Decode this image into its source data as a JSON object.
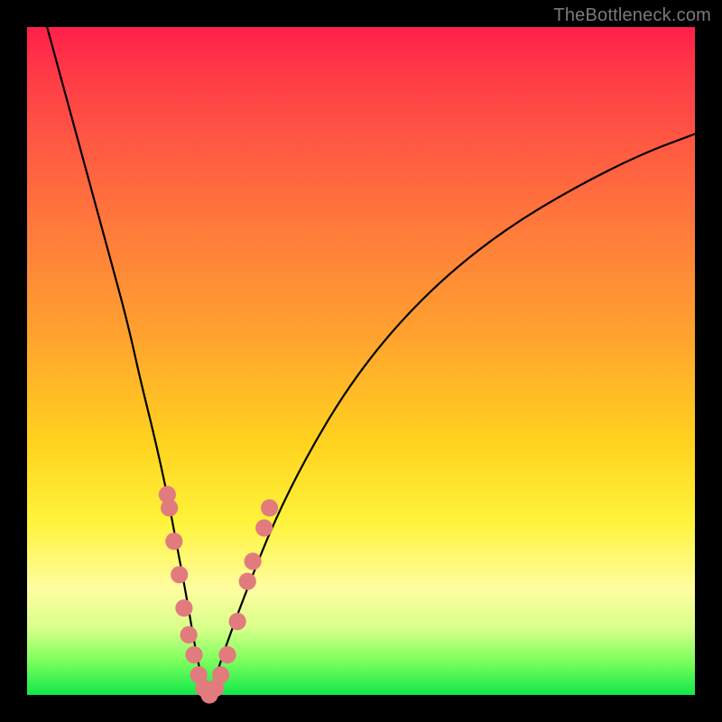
{
  "watermark": "TheBottleneck.com",
  "chart_data": {
    "type": "line",
    "title": "",
    "xlabel": "",
    "ylabel": "",
    "xlim": [
      0,
      100
    ],
    "ylim": [
      0,
      100
    ],
    "grid": false,
    "series": [
      {
        "name": "curve",
        "x": [
          3,
          6,
          9,
          12,
          15,
          17,
          19,
          21,
          22.5,
          24,
          25,
          26,
          27,
          28,
          30,
          33,
          37,
          42,
          48,
          55,
          63,
          72,
          82,
          92,
          100
        ],
        "y": [
          100,
          89,
          78,
          67,
          56,
          47,
          39,
          30,
          22,
          14,
          8,
          3,
          0,
          2,
          8,
          16,
          26,
          36,
          46,
          55,
          63,
          70,
          76,
          81,
          84
        ]
      }
    ],
    "markers": [
      {
        "name": "pink-dots",
        "color": "#e27b7e",
        "radius_plot_units": 1.3,
        "points": [
          {
            "x": 21.0,
            "y": 30
          },
          {
            "x": 21.3,
            "y": 28
          },
          {
            "x": 22.0,
            "y": 23
          },
          {
            "x": 22.8,
            "y": 18
          },
          {
            "x": 23.5,
            "y": 13
          },
          {
            "x": 24.2,
            "y": 9
          },
          {
            "x": 25.0,
            "y": 6
          },
          {
            "x": 25.7,
            "y": 3
          },
          {
            "x": 26.5,
            "y": 1
          },
          {
            "x": 27.3,
            "y": 0
          },
          {
            "x": 28.2,
            "y": 1
          },
          {
            "x": 29.0,
            "y": 3
          },
          {
            "x": 30.0,
            "y": 6
          },
          {
            "x": 31.5,
            "y": 11
          },
          {
            "x": 33.0,
            "y": 17
          },
          {
            "x": 33.8,
            "y": 20
          },
          {
            "x": 35.5,
            "y": 25
          },
          {
            "x": 36.3,
            "y": 28
          }
        ]
      }
    ]
  }
}
